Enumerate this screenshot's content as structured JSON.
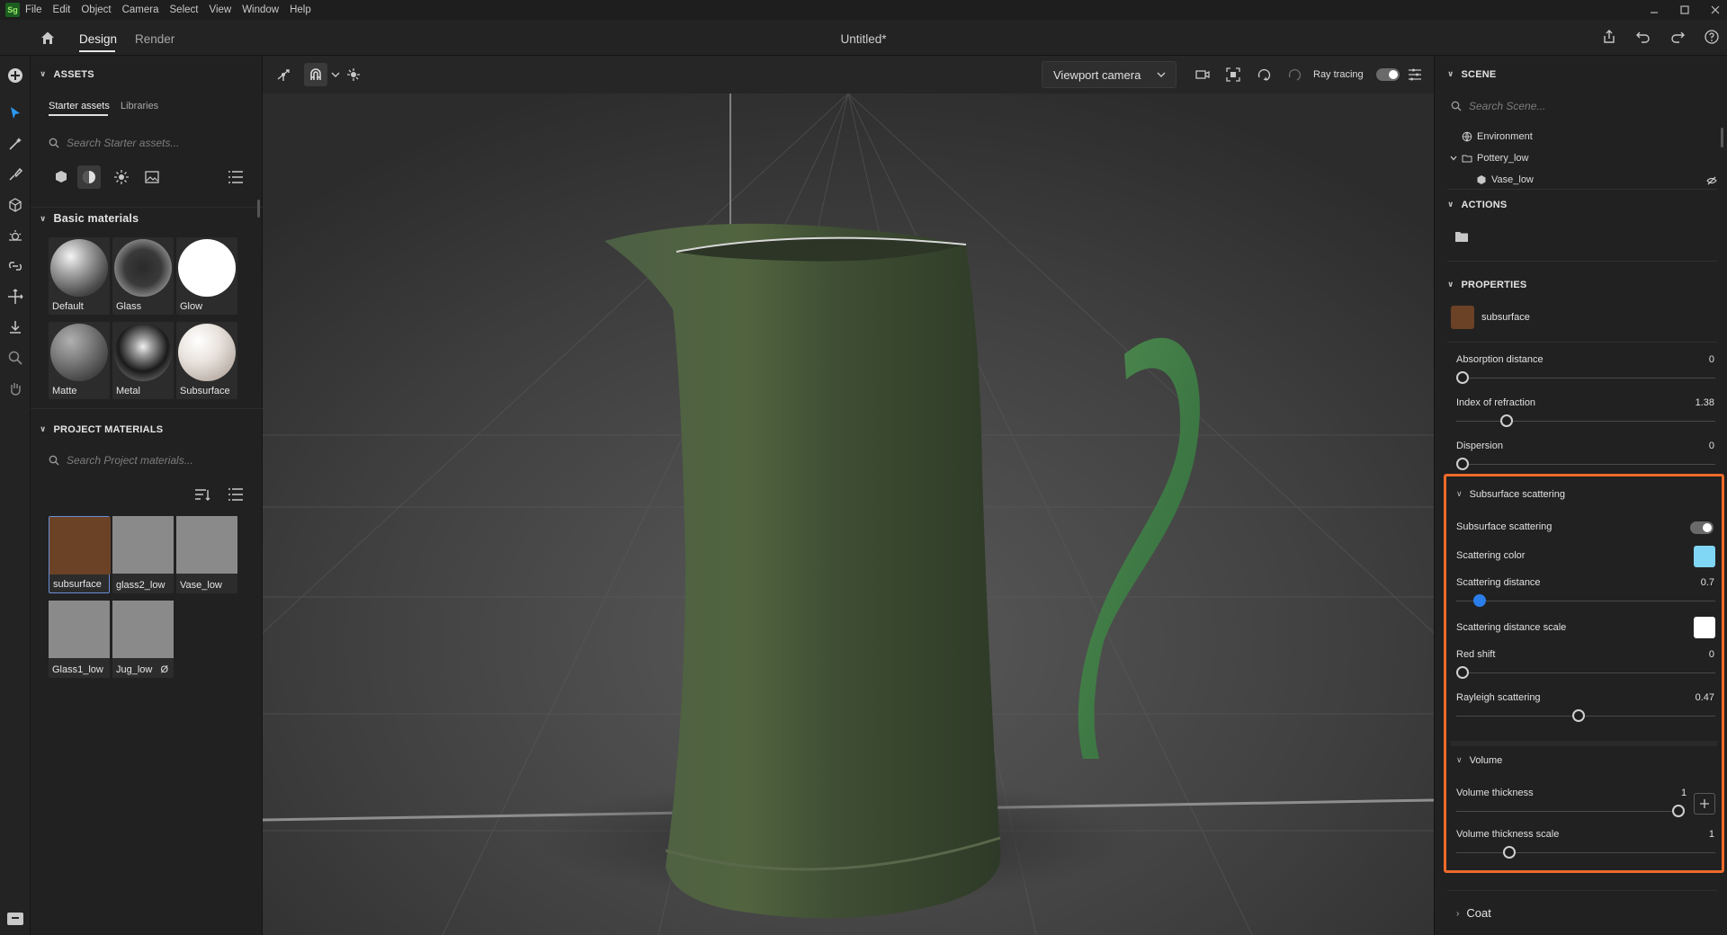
{
  "app": {
    "logo": "Sg",
    "menu": [
      "File",
      "Edit",
      "Object",
      "Camera",
      "Select",
      "View",
      "Window",
      "Help"
    ],
    "window_controls": [
      "minimize-icon",
      "maximize-icon",
      "close-icon"
    ]
  },
  "topbar": {
    "tabs": [
      {
        "label": "Design",
        "active": true
      },
      {
        "label": "Render",
        "active": false
      }
    ],
    "title": "Untitled*",
    "right_icons": [
      "share-icon",
      "undo-icon",
      "redo-icon",
      "help-icon"
    ]
  },
  "toolrail": [
    "add-icon",
    "select-tool-icon",
    "magic-wand-icon",
    "paint-icon",
    "cube-icon",
    "sun-icon",
    "link-icon",
    "move-icon",
    "drop-to-ground-icon",
    "zoom-icon",
    "hand-icon",
    "archive-icon"
  ],
  "assets": {
    "header": "ASSETS",
    "tabs": [
      "Starter assets",
      "Libraries"
    ],
    "search_placeholder": "Search Starter assets...",
    "filter_icons": [
      "model-icon",
      "material-icon",
      "light-icon",
      "image-icon"
    ],
    "basic_materials": {
      "title": "Basic materials",
      "items": [
        "Default",
        "Glass",
        "Glow",
        "Matte",
        "Metal",
        "Subsurface"
      ]
    },
    "project_materials": {
      "header": "PROJECT MATERIALS",
      "search_placeholder": "Search Project materials...",
      "items": [
        {
          "label": "subsurface",
          "color": "#6b4226",
          "selected": true
        },
        {
          "label": "glass2_low",
          "color": "#8a8a8a"
        },
        {
          "label": "Vase_low",
          "color": "#8a8a8a"
        },
        {
          "label": "Glass1_low",
          "color": "#8a8a8a"
        },
        {
          "label": "Jug_low",
          "color": "#8a8a8a",
          "badge": "Ø"
        }
      ]
    }
  },
  "viewport": {
    "camera": "Viewport camera",
    "ray_tracing_label": "Ray tracing",
    "ray_tracing_on": true
  },
  "scene": {
    "header": "SCENE",
    "search_placeholder": "Search Scene...",
    "tree": [
      {
        "label": "Environment",
        "icon": "globe-icon",
        "depth": 0
      },
      {
        "label": "Pottery_low",
        "icon": "folder-icon",
        "depth": 0,
        "expanded": true
      },
      {
        "label": "Vase_low",
        "icon": "model-icon",
        "depth": 1,
        "hidden": true
      }
    ]
  },
  "actions": {
    "header": "ACTIONS"
  },
  "properties": {
    "header": "PROPERTIES",
    "material_name": "subsurface",
    "material_color": "#6b4226",
    "absorption_distance": {
      "label": "Absorption distance",
      "value": "0",
      "fraction": 0.0
    },
    "index_of_refraction": {
      "label": "Index of refraction",
      "value": "1.38",
      "fraction": 0.18
    },
    "dispersion": {
      "label": "Dispersion",
      "value": "0",
      "fraction": 0.0
    },
    "subsurface_section": {
      "title": "Subsurface scattering",
      "toggle_label": "Subsurface scattering",
      "toggle_on": true,
      "scattering_color": {
        "label": "Scattering color",
        "color": "#7fd6f5"
      },
      "scattering_distance": {
        "label": "Scattering distance",
        "value": "0.7",
        "fraction": 0.07
      },
      "scattering_distance_scale": {
        "label": "Scattering distance scale",
        "color": "#ffffff"
      },
      "red_shift": {
        "label": "Red shift",
        "value": "0",
        "fraction": 0.0
      },
      "rayleigh_scattering": {
        "label": "Rayleigh scattering",
        "value": "0.47",
        "fraction": 0.47
      }
    },
    "volume_section": {
      "title": "Volume",
      "volume_thickness": {
        "label": "Volume thickness",
        "value": "1",
        "fraction": 1.0
      },
      "volume_thickness_scale": {
        "label": "Volume thickness scale",
        "value": "1",
        "fraction": 0.19
      }
    },
    "coat_section": {
      "title": "Coat"
    }
  }
}
